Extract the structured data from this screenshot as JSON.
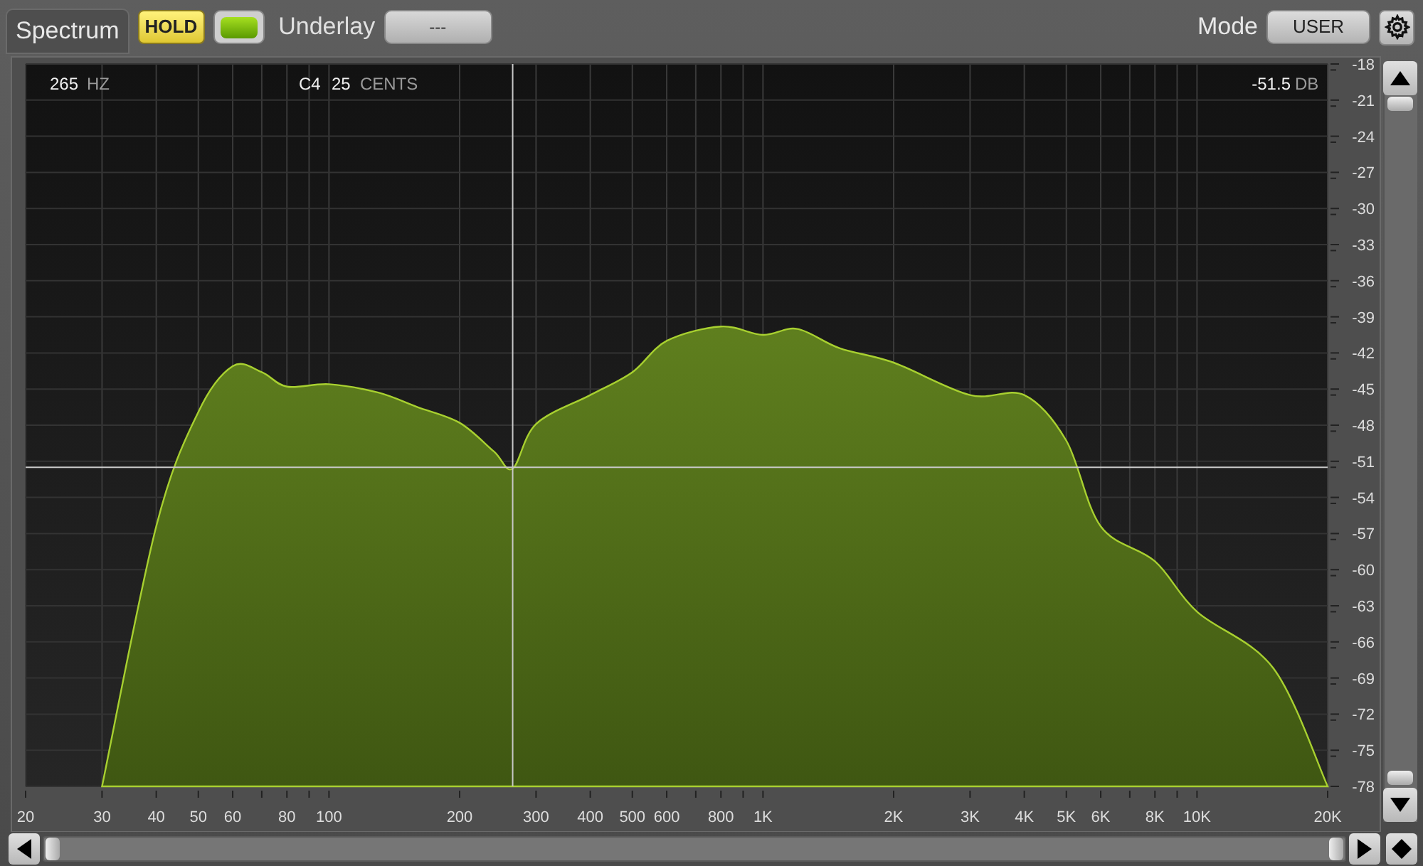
{
  "toolbar": {
    "tab": "Spectrum",
    "hold_button": {
      "label": "HOLD",
      "on": true
    },
    "underlay_toggle": {
      "on": true
    },
    "underlay_label": "Underlay",
    "underlay_value": "---",
    "mode_label": "Mode",
    "mode_value": "USER"
  },
  "readout": {
    "frequency": "265",
    "frequency_unit": "HZ",
    "note": "C4",
    "cents": "25",
    "cents_unit": "CENTS",
    "level": "-51.5",
    "level_unit": "DB"
  },
  "x_axis_labels": [
    "20",
    "30",
    "40",
    "50",
    "60",
    "80",
    "100",
    "200",
    "300",
    "400",
    "500",
    "600",
    "800",
    "1K",
    "2K",
    "3K",
    "4K",
    "5K",
    "6K",
    "8K",
    "10K",
    "20K"
  ],
  "y_axis_labels": [
    "-18",
    "-21",
    "-24",
    "-27",
    "-30",
    "-33",
    "-36",
    "-39",
    "-42",
    "-45",
    "-48",
    "-51",
    "-54",
    "-57",
    "-60",
    "-63",
    "-66",
    "-69",
    "-72",
    "-75",
    "-78"
  ]
}
